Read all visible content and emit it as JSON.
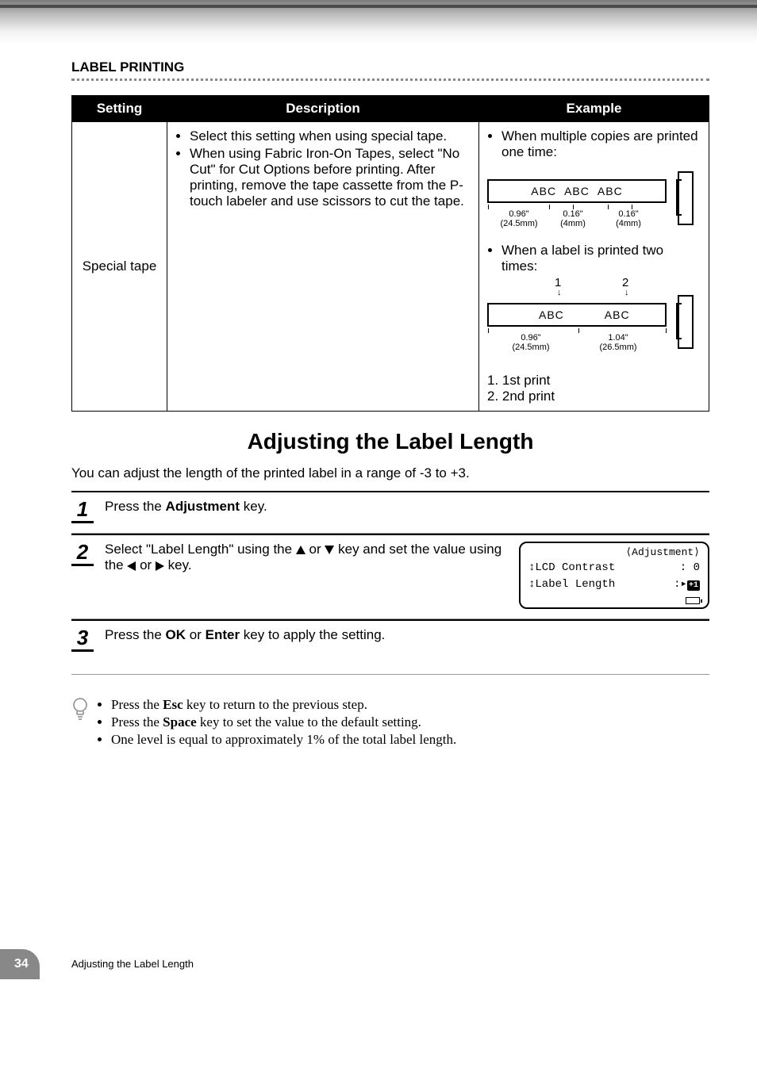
{
  "section_header": "LABEL PRINTING",
  "table": {
    "headers": {
      "setting": "Setting",
      "description": "Description",
      "example": "Example"
    },
    "row": {
      "setting": "Special tape",
      "description_items": [
        "Select this setting when using special tape.",
        "When using Fabric Iron-On Tapes, select \"No Cut\" for Cut Options before printing. After printing, remove the tape cassette from the P-touch labeler and use scissors to cut the tape."
      ],
      "example": {
        "case1_intro": "When multiple copies are printed one time:",
        "strip1": {
          "a": "ABC",
          "b": "ABC",
          "c": "ABC"
        },
        "meas1": {
          "m1_in": "0.96\"",
          "m1_mm": "(24.5mm)",
          "m2_in": "0.16\"",
          "m2_mm": "(4mm)",
          "m3_in": "0.16\"",
          "m3_mm": "(4mm)"
        },
        "case2_intro": "When a label is printed two times:",
        "idx1": "1",
        "idx2": "2",
        "strip2": {
          "a": "ABC",
          "b": "ABC"
        },
        "meas2": {
          "m1_in": "0.96\"",
          "m1_mm": "(24.5mm)",
          "m2_in": "1.04\"",
          "m2_mm": "(26.5mm)"
        },
        "legend1": "1. 1st print",
        "legend2": "2. 2nd print"
      }
    }
  },
  "heading": "Adjusting the Label Length",
  "intro_para": "You can adjust the length of the printed label in a range of -3 to +3.",
  "steps": {
    "s1": {
      "num": "1",
      "before": "Press the ",
      "bold": "Adjustment",
      "after": " key."
    },
    "s2": {
      "num": "2",
      "t1": "Select \"Label Length\" using the ",
      "t2": " or ",
      "t3": " key and set the value using the ",
      "t4": " or ",
      "t5": " key."
    },
    "s3": {
      "num": "3",
      "t1": "Press the ",
      "b1": "OK",
      "t2": " or ",
      "b2": "Enter",
      "t3": " key to apply the setting."
    }
  },
  "lcd": {
    "title": "⟨Adjustment⟩",
    "line1_label": "LCD Contrast",
    "line1_value": ": 0",
    "line2_label": "Label Length",
    "line2_prefix": ":",
    "line2_badge": "+1"
  },
  "tips": [
    {
      "t1": "Press the ",
      "b": "Esc",
      "t2": " key to return to the previous step."
    },
    {
      "t1": "Press the ",
      "b": "Space",
      "t2": " key to set the value to the default setting."
    },
    {
      "t1": "One level is equal to approximately 1% of the total label length.",
      "b": "",
      "t2": ""
    }
  ],
  "footer": {
    "page": "34",
    "caption": "Adjusting the Label Length"
  }
}
